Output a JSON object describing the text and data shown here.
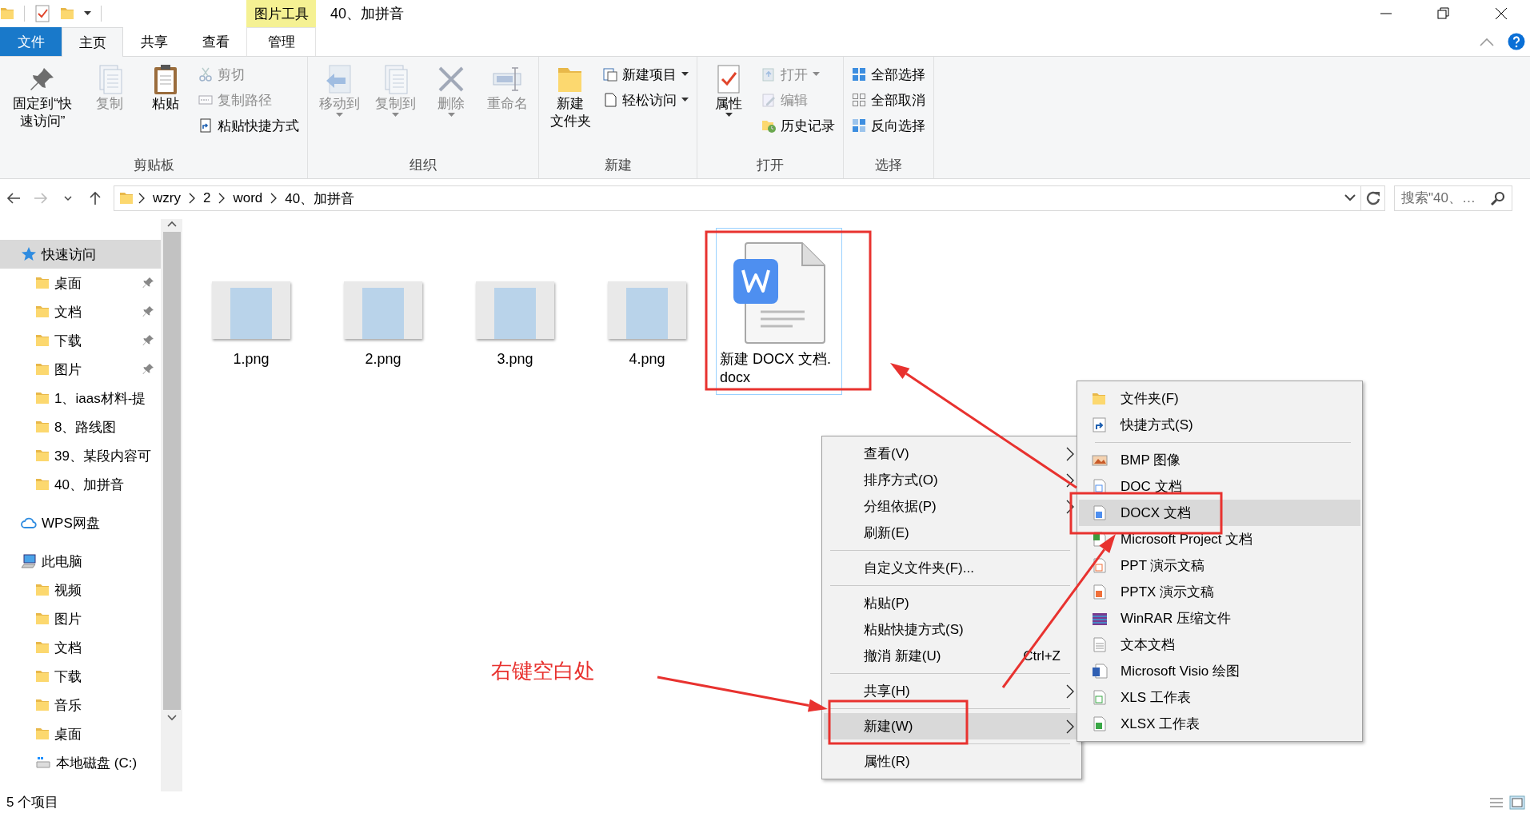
{
  "window": {
    "context_tab_title": "图片工具",
    "title": "40、加拼音"
  },
  "ribbon_tabs": [
    {
      "label": "文件",
      "kind": "file",
      "selected": false
    },
    {
      "label": "主页",
      "kind": "normal",
      "selected": true
    },
    {
      "label": "共享",
      "kind": "normal",
      "selected": false
    },
    {
      "label": "查看",
      "kind": "normal",
      "selected": false
    },
    {
      "label": "管理",
      "kind": "context",
      "selected": false
    }
  ],
  "ribbon_groups": [
    {
      "label": "剪贴板",
      "commands": [
        {
          "label": "固定到“快速访问”",
          "kind": "large",
          "disabled": false,
          "dropdown": false
        },
        {
          "label": "复制",
          "kind": "large",
          "disabled": true,
          "dropdown": false
        },
        {
          "label": "粘贴",
          "kind": "large",
          "disabled": false,
          "dropdown": false
        },
        {
          "label": "剪切",
          "kind": "small",
          "disabled": true,
          "dropdown": false
        },
        {
          "label": "复制路径",
          "kind": "small",
          "disabled": true,
          "dropdown": false
        },
        {
          "label": "粘贴快捷方式",
          "kind": "small",
          "disabled": false,
          "dropdown": false
        }
      ]
    },
    {
      "label": "组织",
      "commands": [
        {
          "label": "移动到",
          "kind": "large",
          "disabled": true,
          "dropdown": true
        },
        {
          "label": "复制到",
          "kind": "large",
          "disabled": true,
          "dropdown": true
        },
        {
          "label": "删除",
          "kind": "large",
          "disabled": true,
          "dropdown": true
        },
        {
          "label": "重命名",
          "kind": "large",
          "disabled": true,
          "dropdown": false
        }
      ]
    },
    {
      "label": "新建",
      "commands": [
        {
          "label_lines": [
            "新建",
            "文件夹"
          ],
          "kind": "large",
          "disabled": false,
          "dropdown": false
        },
        {
          "label": "新建项目",
          "kind": "small",
          "disabled": false,
          "dropdown": true
        },
        {
          "label": "轻松访问",
          "kind": "small",
          "disabled": false,
          "dropdown": true
        }
      ]
    },
    {
      "label": "打开",
      "commands": [
        {
          "label": "属性",
          "kind": "large",
          "disabled": false,
          "dropdown": true
        },
        {
          "label": "打开",
          "kind": "small",
          "disabled": true,
          "dropdown": true
        },
        {
          "label": "编辑",
          "kind": "small",
          "disabled": true,
          "dropdown": false
        },
        {
          "label": "历史记录",
          "kind": "small",
          "disabled": false,
          "dropdown": false
        }
      ]
    },
    {
      "label": "选择",
      "commands": [
        {
          "label": "全部选择",
          "kind": "small",
          "disabled": false,
          "dropdown": false
        },
        {
          "label": "全部取消",
          "kind": "small",
          "disabled": false,
          "dropdown": false
        },
        {
          "label": "反向选择",
          "kind": "small",
          "disabled": false,
          "dropdown": false
        }
      ]
    }
  ],
  "address_bar": {
    "path": [
      "wzry",
      "2",
      "word",
      "40、加拼音"
    ],
    "search_placeholder": "搜索\"40、…"
  },
  "navigation": [
    {
      "label": "快速访问",
      "selected": true,
      "pinned": false,
      "children": [
        {
          "label": "桌面",
          "selected": false,
          "pinned": true
        },
        {
          "label": "文档",
          "selected": false,
          "pinned": true
        },
        {
          "label": "下载",
          "selected": false,
          "pinned": true
        },
        {
          "label": "图片",
          "selected": false,
          "pinned": true
        },
        {
          "label": "1、iaas材料-提",
          "selected": false,
          "pinned": false
        },
        {
          "label": "8、路线图",
          "selected": false,
          "pinned": false
        },
        {
          "label": "39、某段内容可",
          "selected": false,
          "pinned": false
        },
        {
          "label": "40、加拼音",
          "selected": false,
          "pinned": false
        }
      ]
    },
    {
      "label": "WPS网盘",
      "selected": false,
      "pinned": false
    },
    {
      "label": "此电脑",
      "selected": false,
      "pinned": false,
      "children": [
        {
          "label": "视频",
          "selected": false,
          "pinned": false
        },
        {
          "label": "图片",
          "selected": false,
          "pinned": false
        },
        {
          "label": "文档",
          "selected": false,
          "pinned": false
        },
        {
          "label": "下载",
          "selected": false,
          "pinned": false
        },
        {
          "label": "音乐",
          "selected": false,
          "pinned": false
        },
        {
          "label": "桌面",
          "selected": false,
          "pinned": false
        },
        {
          "label": "本地磁盘 (C:)",
          "selected": false,
          "pinned": false
        }
      ]
    }
  ],
  "files": [
    {
      "name": "1.png",
      "kind": "image",
      "focused": false
    },
    {
      "name": "2.png",
      "kind": "image",
      "focused": false
    },
    {
      "name": "3.png",
      "kind": "image",
      "focused": false
    },
    {
      "name": "4.png",
      "kind": "image",
      "focused": false
    },
    {
      "name": "新建 DOCX 文档.docx",
      "kind": "document",
      "focused": true
    }
  ],
  "context_menu": [
    {
      "kind": "item",
      "label": "查看(V)",
      "submenu": true,
      "highlighted": false
    },
    {
      "kind": "item",
      "label": "排序方式(O)",
      "submenu": true,
      "highlighted": false
    },
    {
      "kind": "item",
      "label": "分组依据(P)",
      "submenu": true,
      "highlighted": false
    },
    {
      "kind": "item",
      "label": "刷新(E)",
      "submenu": false,
      "highlighted": false
    },
    {
      "kind": "separator"
    },
    {
      "kind": "item",
      "label": "自定义文件夹(F)...",
      "submenu": false,
      "highlighted": false
    },
    {
      "kind": "separator"
    },
    {
      "kind": "item",
      "label": "粘贴(P)",
      "submenu": false,
      "highlighted": false
    },
    {
      "kind": "item",
      "label": "粘贴快捷方式(S)",
      "submenu": false,
      "highlighted": false
    },
    {
      "kind": "item",
      "label": "撤消 新建(U)",
      "shortcut": "Ctrl+Z",
      "submenu": false,
      "highlighted": false
    },
    {
      "kind": "separator"
    },
    {
      "kind": "item",
      "label": "共享(H)",
      "submenu": true,
      "highlighted": false
    },
    {
      "kind": "separator"
    },
    {
      "kind": "item",
      "label": "新建(W)",
      "submenu": true,
      "highlighted": true
    },
    {
      "kind": "separator"
    },
    {
      "kind": "item",
      "label": "属性(R)",
      "submenu": false,
      "highlighted": false
    }
  ],
  "new_submenu": [
    {
      "kind": "item",
      "label": "文件夹(F)",
      "highlighted": false
    },
    {
      "kind": "item",
      "label": "快捷方式(S)",
      "highlighted": false
    },
    {
      "kind": "separator"
    },
    {
      "kind": "item",
      "label": "BMP 图像",
      "highlighted": false
    },
    {
      "kind": "item",
      "label": "DOC 文档",
      "highlighted": false
    },
    {
      "kind": "item",
      "label": "DOCX 文档",
      "highlighted": true
    },
    {
      "kind": "item",
      "label": "Microsoft Project 文档",
      "highlighted": false
    },
    {
      "kind": "item",
      "label": "PPT 演示文稿",
      "highlighted": false
    },
    {
      "kind": "item",
      "label": "PPTX 演示文稿",
      "highlighted": false
    },
    {
      "kind": "item",
      "label": "WinRAR 压缩文件",
      "highlighted": false
    },
    {
      "kind": "item",
      "label": "文本文档",
      "highlighted": false
    },
    {
      "kind": "item",
      "label": "Microsoft Visio 绘图",
      "highlighted": false
    },
    {
      "kind": "item",
      "label": "XLS 工作表",
      "highlighted": false
    },
    {
      "kind": "item",
      "label": "XLSX 工作表",
      "highlighted": false
    }
  ],
  "annotation": {
    "label": "右键空白处"
  },
  "status_bar": {
    "item_count": "5 个项目"
  }
}
